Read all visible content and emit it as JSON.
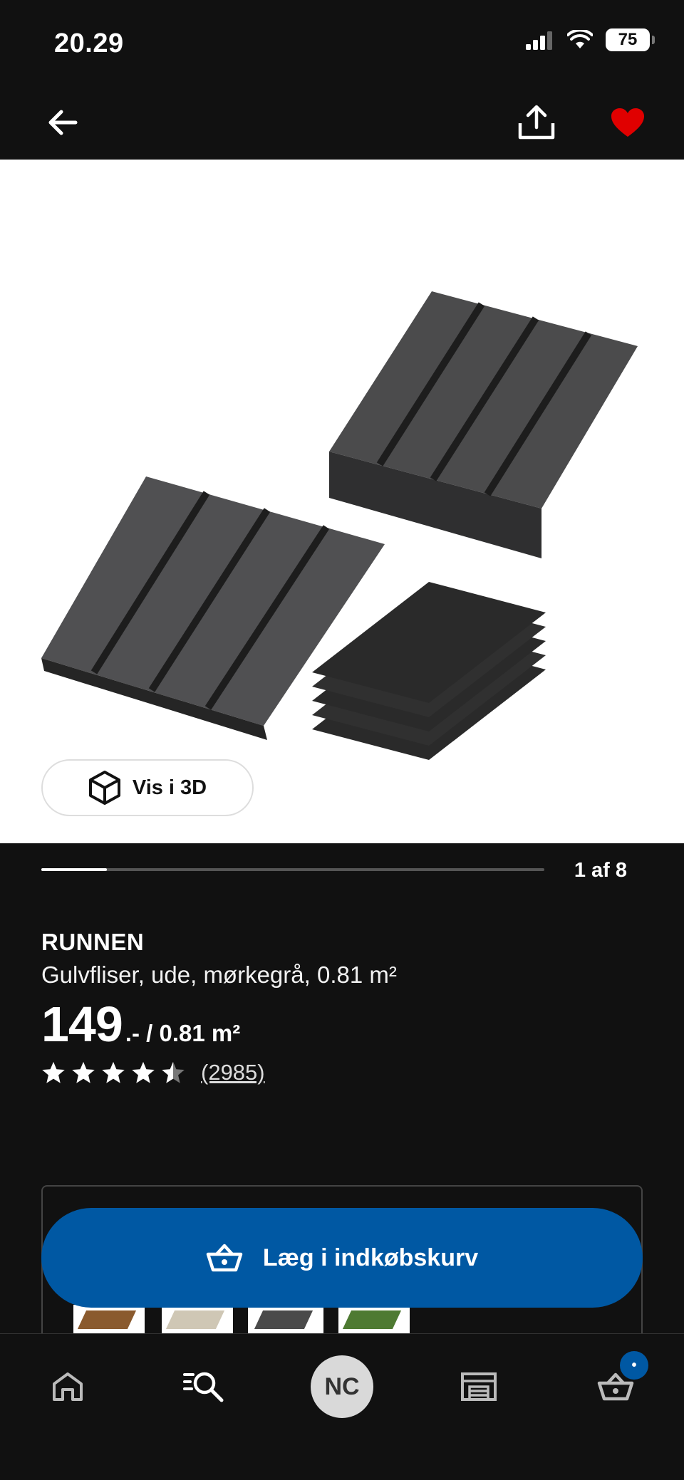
{
  "status_bar": {
    "time": "20.29",
    "battery": "75"
  },
  "top_nav": {
    "back_icon": "arrow-left-icon",
    "share_icon": "share-icon",
    "favorite_icon": "heart-icon",
    "favorite_color": "#e00000"
  },
  "gallery": {
    "view_3d_label": "Vis i 3D",
    "page_indicator": "1 af 8",
    "progress": 0.13
  },
  "product": {
    "name": "RUNNEN",
    "description": "Gulvfliser, ude, mørkegrå, 0.81 m²",
    "price_integer": "149",
    "price_suffix": ".- / 0.81 m²",
    "rating": 4.5,
    "review_count": "(2985)"
  },
  "variants": [
    {
      "name": "brown",
      "color": "#8a5a2e"
    },
    {
      "name": "beige",
      "color": "#cfc7b5"
    },
    {
      "name": "dark-grey",
      "color": "#4a4a4a"
    },
    {
      "name": "green",
      "color": "#4e7a32"
    }
  ],
  "cart_button": {
    "label": "Læg i indkøbskurv",
    "color": "#0058a3"
  },
  "bottom_nav": {
    "avatar_initials": "NC",
    "cart_badge": "•"
  }
}
